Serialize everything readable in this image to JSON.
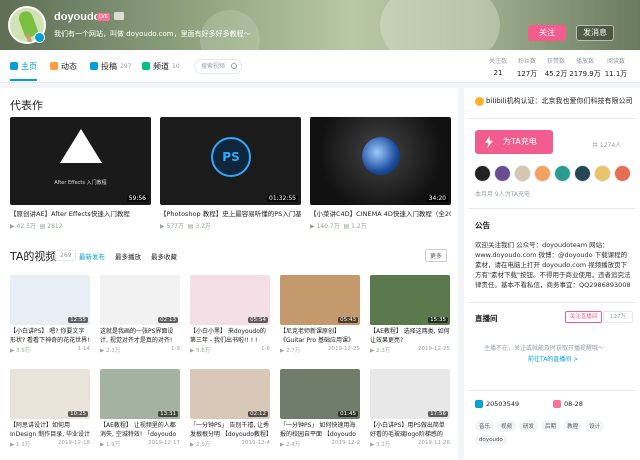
{
  "header": {
    "username": "doyoudo",
    "level": "LV6",
    "signature": "我们有一个网站，叫做 doyoudo.com，里面有好多好多教程～",
    "follow_label": "关注",
    "message_label": "发消息"
  },
  "nav": {
    "tabs": [
      {
        "label": "主页",
        "count": ""
      },
      {
        "label": "动态",
        "count": ""
      },
      {
        "label": "投稿",
        "count": "297"
      },
      {
        "label": "频道",
        "count": "10"
      }
    ],
    "search_placeholder": "搜索视频"
  },
  "stats": [
    {
      "label": "关注数",
      "value": "21"
    },
    {
      "label": "粉丝数",
      "value": "127万"
    },
    {
      "label": "获赞数",
      "value": "45.2万"
    },
    {
      "label": "播放数",
      "value": "2179.9万"
    },
    {
      "label": "阅读数",
      "value": "11.1万"
    }
  ],
  "masterpiece": {
    "title": "代表作",
    "items": [
      {
        "title": "【原创讲AE】After Effects快速入门教程",
        "duration": "59:56",
        "plays": "42.5万",
        "danmaku": "2812",
        "thumb_text": "After Effects 入门教程"
      },
      {
        "title": "【Photoshop 教程】史上最容易听懂的PS入门基础",
        "duration": "01:32:55",
        "plays": "577万",
        "danmaku": "3.2万",
        "thumb_text": "PS"
      },
      {
        "title": "【小菜讲C4D】CINEMA 4D快速入门教程（全20",
        "duration": "34:20",
        "plays": "140.7万",
        "danmaku": "1.2万",
        "thumb_text": ""
      }
    ]
  },
  "videos_section": {
    "title": "TA的视频",
    "count": "269",
    "tabs": [
      "最新发布",
      "最多播放",
      "最多收藏"
    ],
    "more_label": "更多"
  },
  "videos": [
    {
      "title": "【小白讲PS】 嗯? 你要文字形状? 看看下神奇的花花世界!",
      "duration": "12:55",
      "plays": "3.9万",
      "date": "1-14"
    },
    {
      "title": "这就是我画的一张PS界面设计, 视觉对齐才是真的对齐! 【doyoudo】",
      "duration": "02:13",
      "plays": "2.3万",
      "date": "1-9"
    },
    {
      "title": "【小白小黑】 来doyoudo的第三年 - 我们出书啦!! ! !",
      "duration": "05:54",
      "plays": "5.6万",
      "date": "1-6"
    },
    {
      "title": "【尼克老师新课原创】《Guitar Pro 基础应用课》",
      "duration": "05:43",
      "plays": "2.7万",
      "date": "2019-12-25"
    },
    {
      "title": "【AE教程】 选择这两类, 如何让效果更亮?",
      "duration": "15:35",
      "plays": "2.3万",
      "date": "2019-12-25"
    },
    {
      "title": "【阿思讲设计】如何用InDesign 制作目录, 毕业设计",
      "duration": "10:25",
      "plays": "1.3万",
      "date": "2019-12-18"
    },
    {
      "title": "【AE教程】 让视频里的人都消失, 空城特效! 「doyoudo",
      "duration": "13:31",
      "plays": "1.9万",
      "date": "2019-12-17"
    },
    {
      "title": "「一分钟PS」 告别千禧, 让秀发根根分明 【doyoudo教程】",
      "duration": "02:12",
      "plays": "2.5万",
      "date": "2019-12-4"
    },
    {
      "title": "「一分钟PS」 如何快速用海报的校园自平面 【doyoudo教",
      "duration": "01:45",
      "plays": "2.4万",
      "date": "2019-12-2"
    },
    {
      "title": "【小白讲PS】用PS做出简单好看的毛玻璃logo阶梯感的【doyoudo",
      "duration": "17:56",
      "plays": "3.2万",
      "date": "2019-11-26"
    }
  ],
  "sidebar": {
    "certification": "bilibili机构认证：北京我也爱你们科技有限公司",
    "charge_label": "为TA充电",
    "charge_count": "共 1274人",
    "charge_month": "本月月 9人为TA充电",
    "notice_title": "公告",
    "notice": "欢迎关注我们 公众号：doyoudoteam 网站：www.doyoudo.com 微博：@doyoudo 下载课程的素材，请在电脑上打开 doyoudo.com 视频播放页下方有\"素材下载\"按钮。不得用于商业使用，违者追究法律责任。基本不看私信，商务事宜：QQ2986893008",
    "live_title": "直播间",
    "live_follow": "关注直播间",
    "live_count": "127万",
    "live_tip": "主播不在，关注或就能及时获取开播提醒哦～",
    "live_link": "前往TA的直播间 >",
    "uid": "20503549",
    "birthday": "08-28",
    "tags": [
      "音乐",
      "视频",
      "研发",
      "后期",
      "教程",
      "设计",
      "doyoudo"
    ]
  },
  "colors": {
    "accent": "#00a1d6",
    "pink": "#f25d8e"
  }
}
